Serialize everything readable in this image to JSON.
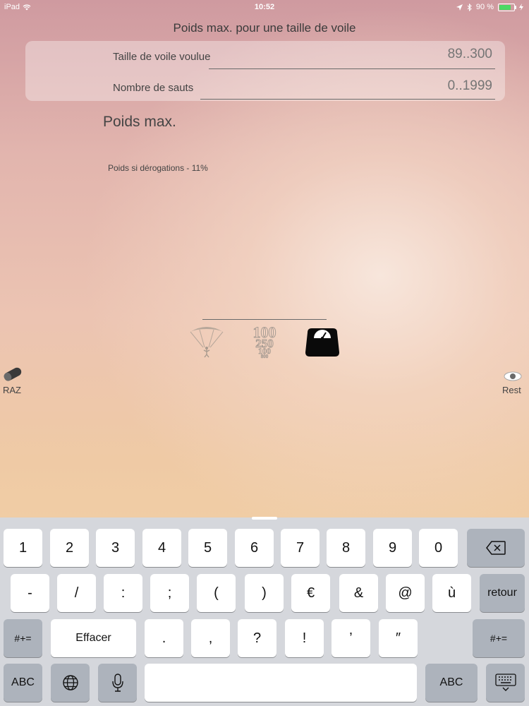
{
  "status": {
    "device": "iPad",
    "time": "10:52",
    "battery": "90 %",
    "battery_level": 0.9
  },
  "title": "Poids max. pour une taille de voile",
  "form": {
    "sail_size": {
      "label": "Taille de voile voulue",
      "placeholder": "89..300",
      "value": ""
    },
    "jumps": {
      "label": "Nombre de sauts",
      "placeholder": "0..1999",
      "value": ""
    }
  },
  "result": {
    "title": "Poids max.",
    "derogation": "Poids si dérogations  - 11%"
  },
  "toolbar": {
    "icons": [
      "parachute-icon",
      "sizes-icon",
      "scale-icon"
    ],
    "sizes_text": [
      "100",
      "250",
      "100",
      "800"
    ]
  },
  "side_buttons": {
    "raz": "RAZ",
    "rest": "Rest"
  },
  "keyboard": {
    "row1": [
      "1",
      "2",
      "3",
      "4",
      "5",
      "6",
      "7",
      "8",
      "9",
      "0"
    ],
    "row2": [
      "-",
      "/",
      ":",
      ";",
      "(",
      ")",
      "€",
      "&",
      "@",
      "ù"
    ],
    "row2_return": "retour",
    "row3_left": "#+=",
    "row3_clear": "Effacer",
    "row3": [
      ".",
      ",",
      "?",
      "!",
      "’",
      "″"
    ],
    "row3_right": "#+=",
    "row4_left": "ABC",
    "row4_right": "ABC"
  }
}
